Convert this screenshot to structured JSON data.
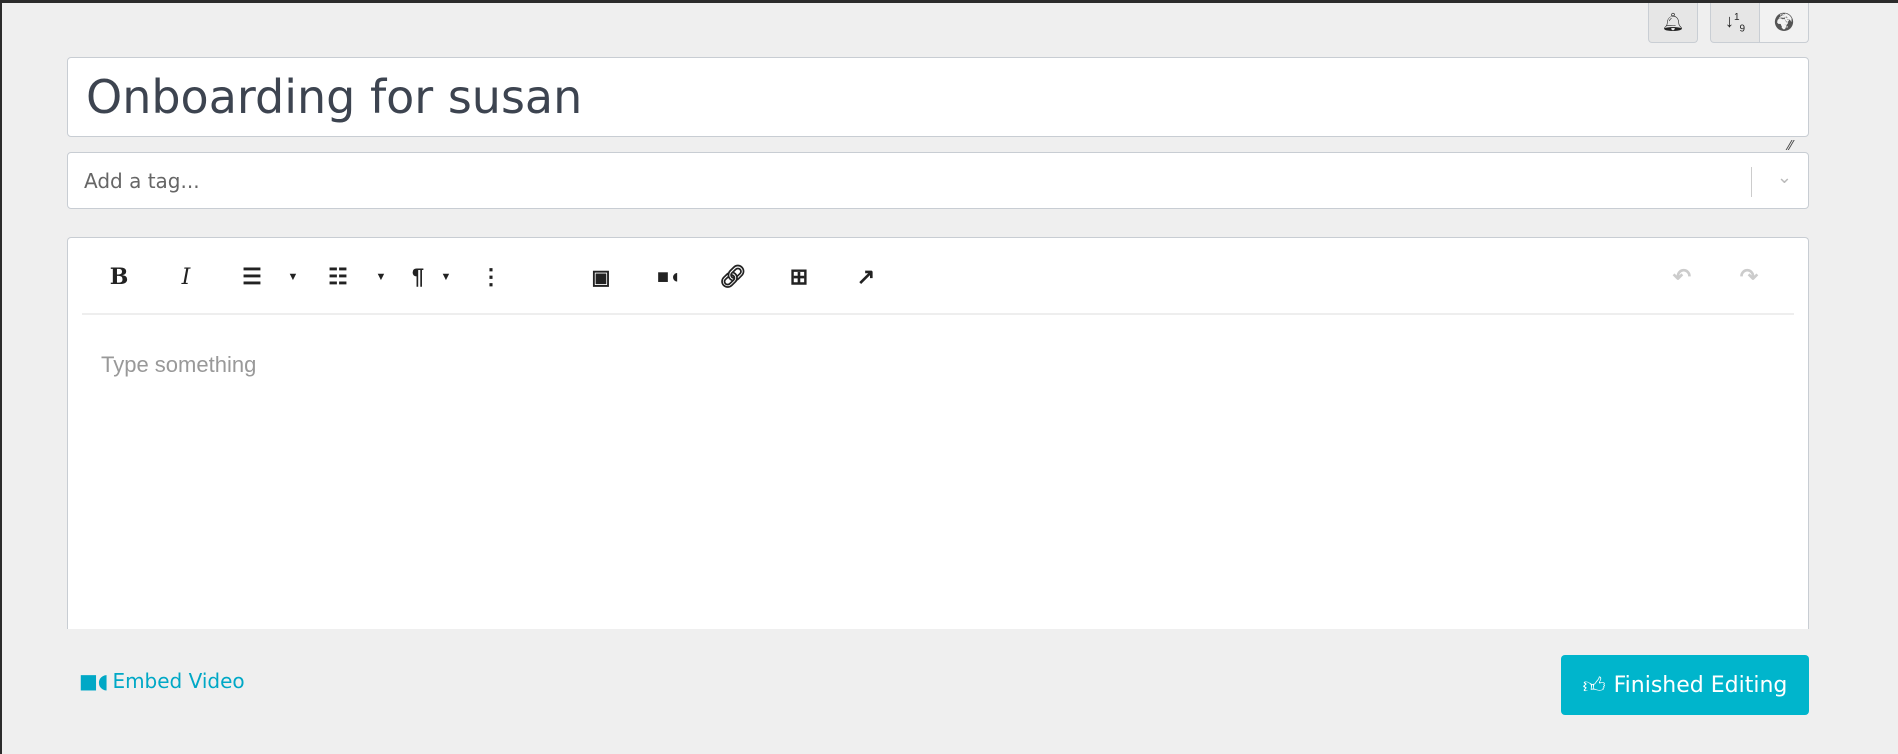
{
  "header": {
    "notifications_icon": "bell-icon",
    "sort_icon": "sort-numeric-icon",
    "visibility_icon": "globe-icon"
  },
  "title": {
    "value": "Onboarding for susan"
  },
  "tags": {
    "placeholder": "Add a tag..."
  },
  "editor": {
    "placeholder": "Type something",
    "toolbar": [
      "bold",
      "italic",
      "ordered-list",
      "bullet-list",
      "paragraph",
      "more",
      "image",
      "video",
      "link",
      "table",
      "external-link",
      "undo",
      "redo"
    ]
  },
  "footer": {
    "embed_label": "Embed Video",
    "finish_label": "Finished Editing",
    "accent": "#00b5cc"
  }
}
